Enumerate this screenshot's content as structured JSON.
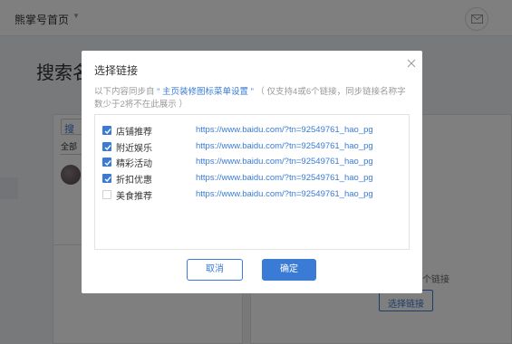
{
  "header": {
    "brand": "熊掌号首页"
  },
  "background": {
    "page_title": "搜索名",
    "search_button_label": "搜",
    "tab_all": "全部",
    "hint_text": "个链接",
    "select_link_button": "选择链接"
  },
  "modal": {
    "title": "选择链接",
    "desc_prefix": "以下内容同步自",
    "desc_link": "“ 主页装修图标菜单设置 ”",
    "desc_suffix": "（ 仅支持4或6个链接，同步链接名称字数少于2将不在此展示 ）",
    "items": [
      {
        "label": "店铺推荐",
        "url": "https://www.baidu.com/?tn=92549761_hao_pg",
        "checked": true
      },
      {
        "label": "附近娱乐",
        "url": "https://www.baidu.com/?tn=92549761_hao_pg",
        "checked": true
      },
      {
        "label": "精彩活动",
        "url": "https://www.baidu.com/?tn=92549761_hao_pg",
        "checked": true
      },
      {
        "label": "折扣优惠",
        "url": "https://www.baidu.com/?tn=92549761_hao_pg",
        "checked": true
      },
      {
        "label": "美食推荐",
        "url": "https://www.baidu.com/?tn=92549761_hao_pg",
        "checked": false
      }
    ],
    "cancel_label": "取消",
    "ok_label": "确定"
  },
  "colors": {
    "accent": "#3a7bd5",
    "overlay": "rgba(0,0,0,0.5)"
  }
}
